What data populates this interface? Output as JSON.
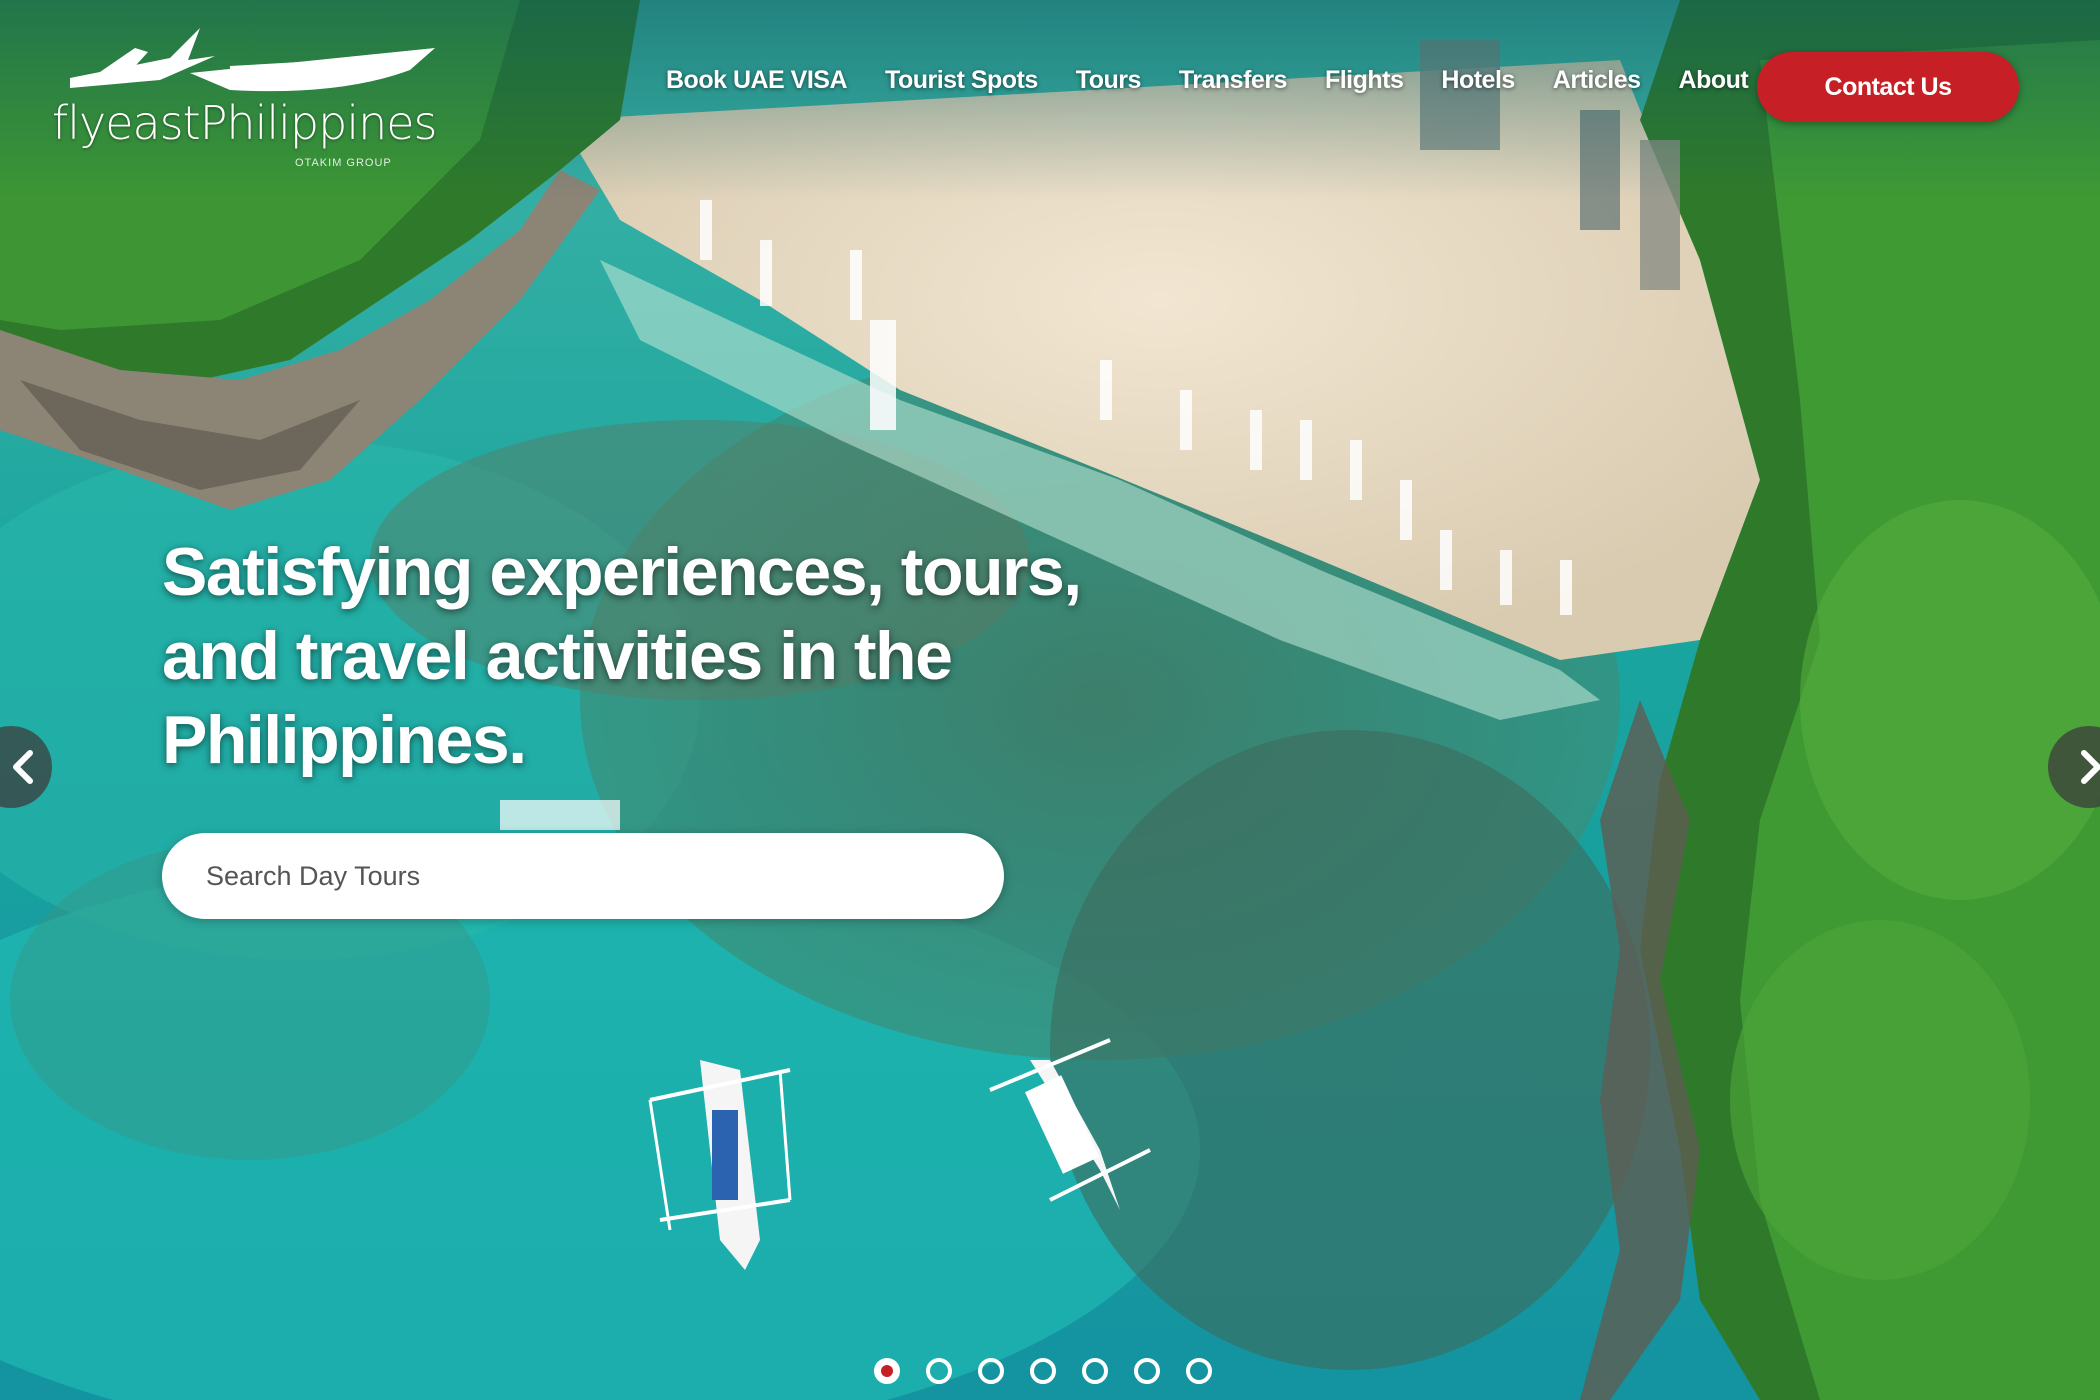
{
  "brand": {
    "logo_text": "flyeastPhilippines",
    "logo_subtext": "OTAKIM GROUP",
    "accent_color": "#c62026"
  },
  "nav": {
    "items": [
      {
        "label": "Book UAE VISA"
      },
      {
        "label": "Tourist Spots"
      },
      {
        "label": "Tours"
      },
      {
        "label": "Transfers"
      },
      {
        "label": "Flights"
      },
      {
        "label": "Hotels"
      },
      {
        "label": "Articles"
      },
      {
        "label": "About"
      }
    ],
    "contact_label": "Contact Us"
  },
  "hero": {
    "headline_line1": "Satisfying experiences, tours,",
    "headline_line2": "and travel activities in the",
    "headline_line3": "Philippines.",
    "search_placeholder": "Search Day Tours",
    "prev_icon": "chevron-left-icon",
    "next_icon": "chevron-right-icon"
  },
  "carousel": {
    "slide_count": 7,
    "active_slide": 1
  }
}
